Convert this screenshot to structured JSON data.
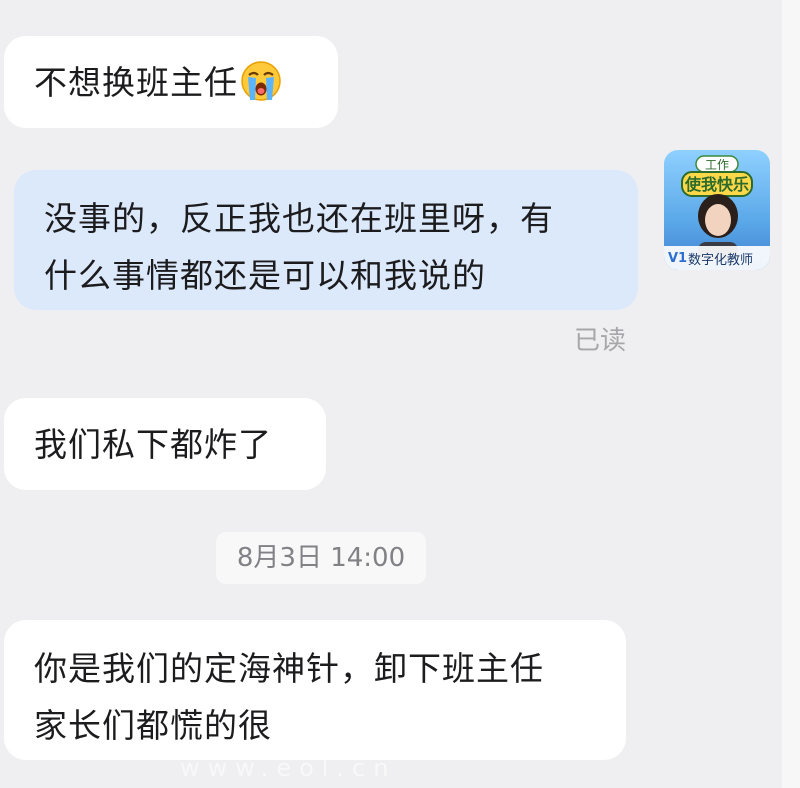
{
  "messages": [
    {
      "id": "msg1",
      "direction": "incoming",
      "text": "不想换班主任",
      "emoji": "crying-face-icon"
    },
    {
      "id": "msg2",
      "direction": "outgoing",
      "text": "没事的，反正我也还在班里呀，有\n什么事情都还是可以和我说的"
    },
    {
      "id": "msg3",
      "direction": "incoming",
      "text": "我们私下都炸了"
    },
    {
      "id": "msg4",
      "direction": "incoming",
      "text": "你是我们的定海神针，卸下班主任\n家长们都慌的很"
    }
  ],
  "read_status": "已读",
  "timestamp": "8月3日 14:00",
  "avatar": {
    "banner_top": "工作",
    "banner_main": "使我快乐",
    "version": "V1",
    "role": "数字化教师"
  },
  "watermark": "www.eol.cn",
  "colors": {
    "background": "#efeff1",
    "incoming_bubble": "#ffffff",
    "outgoing_bubble": "#dce9fb",
    "text": "#1c1c1e",
    "meta_text": "#a7a7ab"
  }
}
